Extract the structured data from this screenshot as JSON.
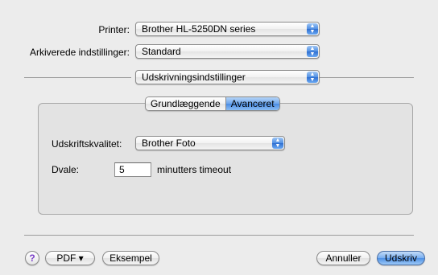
{
  "printer": {
    "label": "Printer:",
    "value": "Brother HL-5250DN series"
  },
  "presets": {
    "label": "Arkiverede indstillinger:",
    "value": "Standard"
  },
  "section": {
    "value": "Udskrivningsindstillinger"
  },
  "tabs": [
    {
      "label": "Grundlæggende",
      "selected": false
    },
    {
      "label": "Avanceret",
      "selected": true
    }
  ],
  "quality": {
    "label": "Udskriftskvalitet:",
    "value": "Brother Foto"
  },
  "sleep": {
    "label": "Dvale:",
    "value": "5",
    "unit_label": "minutters timeout"
  },
  "footer": {
    "help_glyph": "?",
    "pdf_label": "PDF ▾",
    "preview_label": "Eksempel",
    "cancel_label": "Annuller",
    "print_label": "Udskriv"
  },
  "colors": {
    "accent": "#4d8fe5",
    "background": "#ececec",
    "tab_box": "#e3e3e3"
  }
}
